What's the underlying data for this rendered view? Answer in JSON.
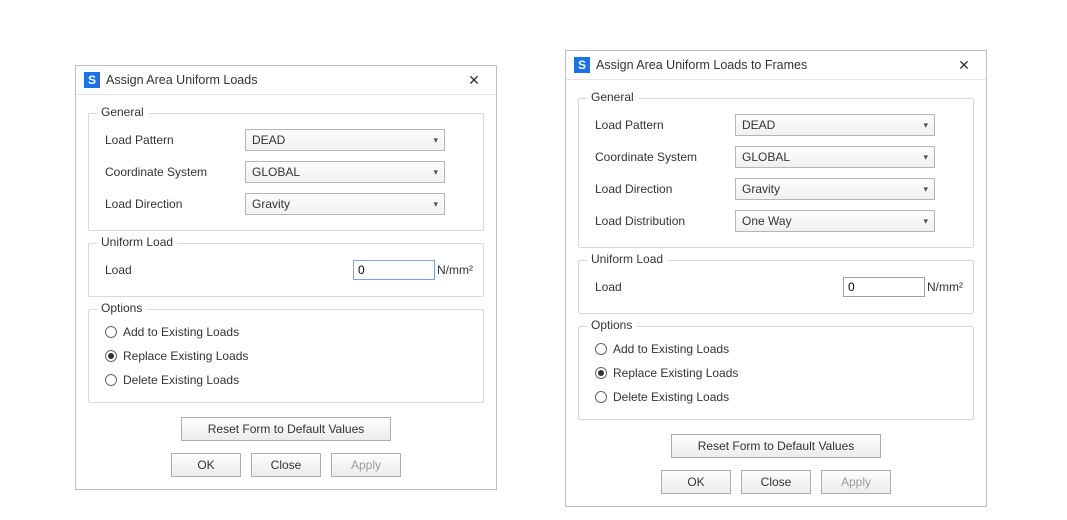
{
  "dialog1": {
    "title": "Assign Area Uniform Loads",
    "app_icon_letter": "S",
    "general": {
      "label": "General",
      "load_pattern_label": "Load Pattern",
      "load_pattern_value": "DEAD",
      "coord_sys_label": "Coordinate System",
      "coord_sys_value": "GLOBAL",
      "load_dir_label": "Load Direction",
      "load_dir_value": "Gravity"
    },
    "uniform": {
      "label": "Uniform Load",
      "load_label": "Load",
      "load_value": "0",
      "unit": "N/mm²"
    },
    "options": {
      "label": "Options",
      "add": "Add to Existing Loads",
      "replace": "Replace Existing Loads",
      "delete": "Delete Existing Loads",
      "selected": "replace"
    },
    "buttons": {
      "reset": "Reset Form to Default Values",
      "ok": "OK",
      "close": "Close",
      "apply": "Apply"
    }
  },
  "dialog2": {
    "title": "Assign Area Uniform Loads to Frames",
    "app_icon_letter": "S",
    "general": {
      "label": "General",
      "load_pattern_label": "Load Pattern",
      "load_pattern_value": "DEAD",
      "coord_sys_label": "Coordinate System",
      "coord_sys_value": "GLOBAL",
      "load_dir_label": "Load Direction",
      "load_dir_value": "Gravity",
      "load_dist_label": "Load Distribution",
      "load_dist_value": "One Way"
    },
    "uniform": {
      "label": "Uniform Load",
      "load_label": "Load",
      "load_value": "0",
      "unit": "N/mm²"
    },
    "options": {
      "label": "Options",
      "add": "Add to Existing Loads",
      "replace": "Replace Existing Loads",
      "delete": "Delete Existing Loads",
      "selected": "replace"
    },
    "buttons": {
      "reset": "Reset Form to Default Values",
      "ok": "OK",
      "close": "Close",
      "apply": "Apply"
    }
  }
}
